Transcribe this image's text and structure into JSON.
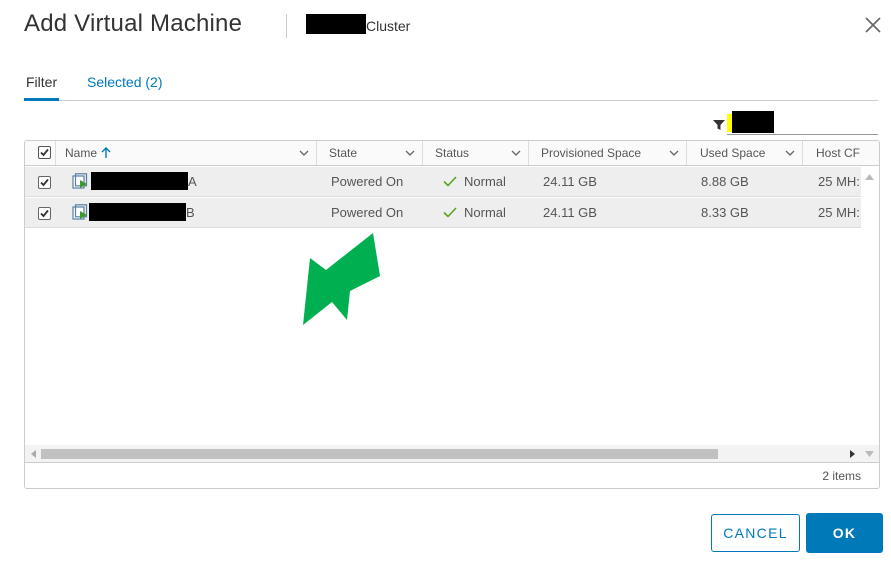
{
  "dialog": {
    "title": "Add Virtual Machine",
    "subtitle": "Cluster",
    "close_icon": "close-icon"
  },
  "tabs": [
    {
      "label": "Filter",
      "active": true
    },
    {
      "label": "Selected (2)",
      "active": false
    }
  ],
  "filter": {
    "icon": "filter-icon",
    "highlight_color": "#ffff00"
  },
  "table": {
    "columns": [
      "Name",
      "State",
      "Status",
      "Provisioned Space",
      "Used Space",
      "Host CF"
    ],
    "sort_column": "Name",
    "sort_direction": "ascending",
    "rows": [
      {
        "checked": true,
        "name_suffix": "A",
        "state": "Powered On",
        "status": "Normal",
        "provisioned": "24.11 GB",
        "used": "8.88 GB",
        "host_cpu": "25 MH:"
      },
      {
        "checked": true,
        "name_suffix": "B",
        "state": "Powered On",
        "status": "Normal",
        "provisioned": "24.11 GB",
        "used": "8.33 GB",
        "host_cpu": "25 MH:"
      }
    ],
    "items_count": "2 items"
  },
  "buttons": {
    "cancel": "CANCEL",
    "ok": "OK"
  },
  "colors": {
    "accent": "#0079b8",
    "status_ok": "#5aa220",
    "annotation_arrow": "#00b050"
  }
}
